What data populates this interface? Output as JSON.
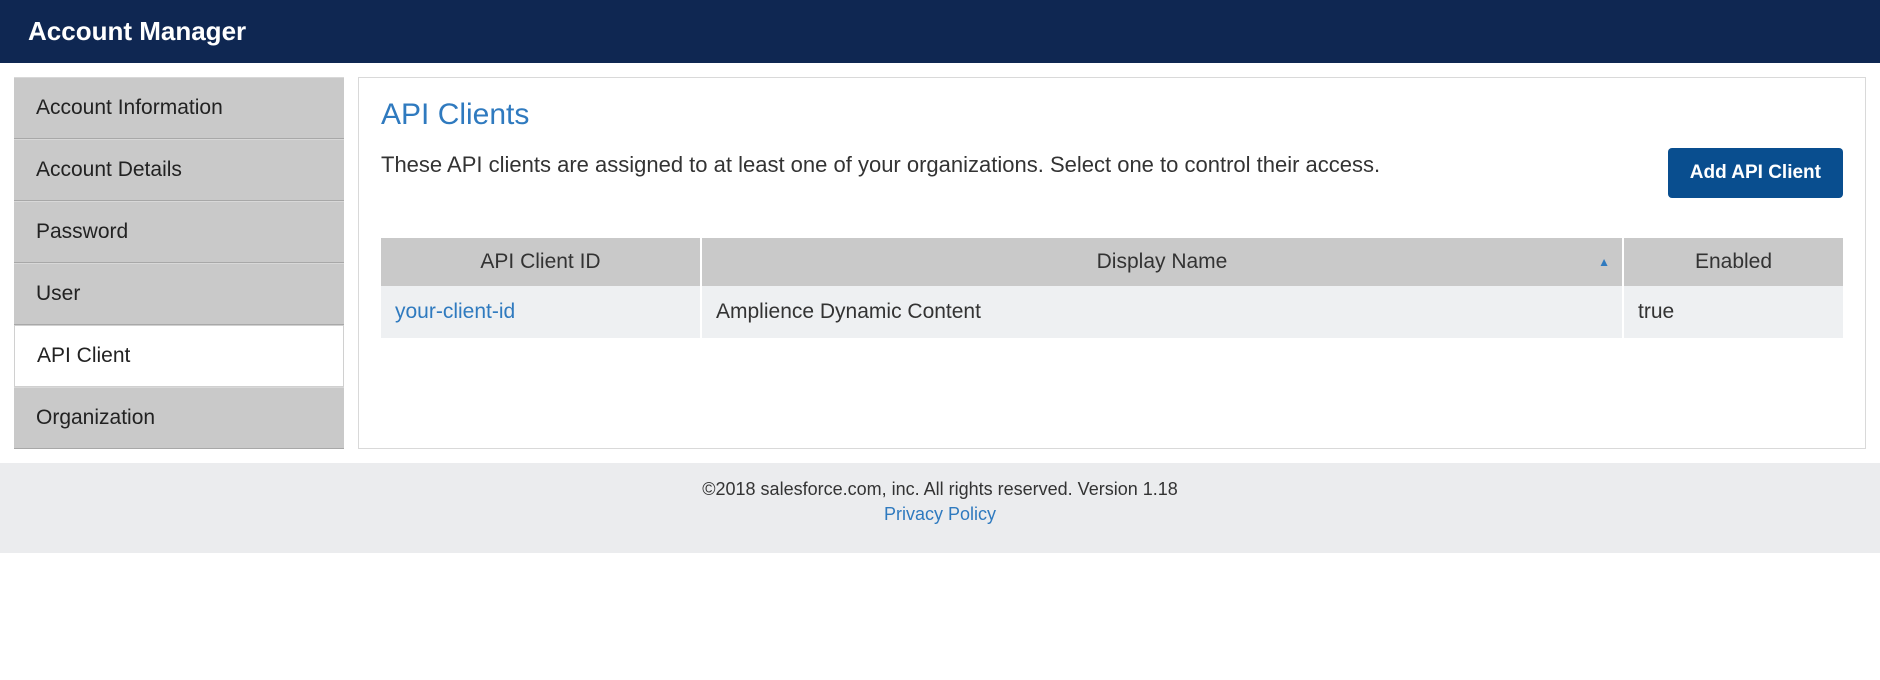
{
  "header": {
    "title": "Account Manager"
  },
  "sidebar": {
    "items": [
      {
        "label": "Account Information",
        "active": false
      },
      {
        "label": "Account Details",
        "active": false
      },
      {
        "label": "Password",
        "active": false
      },
      {
        "label": "User",
        "active": false
      },
      {
        "label": "API Client",
        "active": true
      },
      {
        "label": "Organization",
        "active": false
      }
    ]
  },
  "main": {
    "title": "API Clients",
    "subhead": "These API clients are assigned to at least one of your organizations. Select one to control their access.",
    "add_button": "Add API Client",
    "table": {
      "headers": {
        "client_id": "API Client ID",
        "display_name": "Display Name",
        "enabled": "Enabled"
      },
      "sort_column": "display_name",
      "sort_dir": "asc",
      "rows": [
        {
          "client_id": "your-client-id",
          "display_name": "Amplience Dynamic Content",
          "enabled": "true"
        }
      ]
    }
  },
  "footer": {
    "copyright": "©2018 salesforce.com, inc. All rights reserved. Version 1.18",
    "privacy": "Privacy Policy"
  }
}
